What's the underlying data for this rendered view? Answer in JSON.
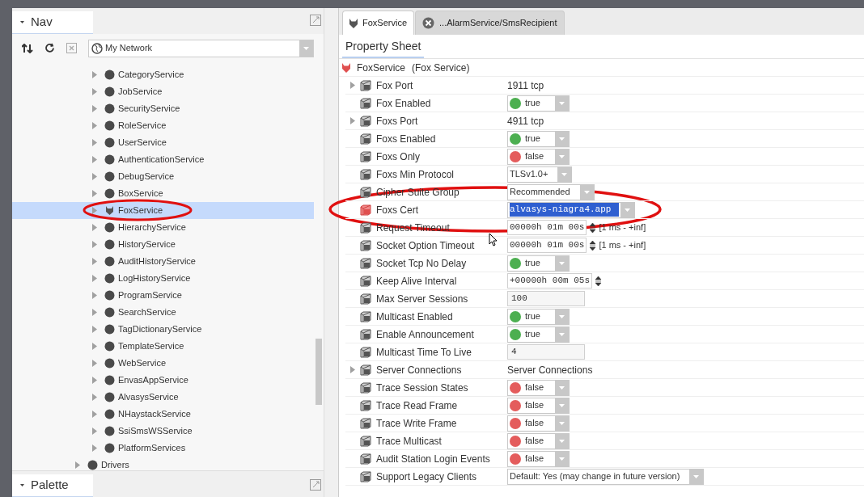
{
  "nav": {
    "title": "Nav",
    "network": "My Network",
    "tree": [
      {
        "children": [
          {
            "label": "CategoryService",
            "expanded": false,
            "selected": false
          },
          {
            "label": "JobService",
            "expanded": false,
            "selected": false
          },
          {
            "label": "SecurityService",
            "expanded": false,
            "selected": false
          },
          {
            "label": "RoleService",
            "expanded": false,
            "selected": false
          },
          {
            "label": "UserService",
            "expanded": false,
            "selected": false
          },
          {
            "label": "AuthenticationService",
            "expanded": false,
            "selected": false
          },
          {
            "label": "DebugService",
            "expanded": false,
            "selected": false
          },
          {
            "label": "BoxService",
            "expanded": false,
            "selected": false
          },
          {
            "label": "FoxService",
            "expanded": false,
            "selected": true
          },
          {
            "label": "HierarchyService",
            "expanded": false,
            "selected": false
          },
          {
            "label": "HistoryService",
            "expanded": false,
            "selected": false
          },
          {
            "label": "AuditHistoryService",
            "expanded": false,
            "selected": false
          },
          {
            "label": "LogHistoryService",
            "expanded": false,
            "selected": false
          },
          {
            "label": "ProgramService",
            "expanded": false,
            "selected": false
          },
          {
            "label": "SearchService",
            "expanded": false,
            "selected": false
          },
          {
            "label": "TagDictionaryService",
            "expanded": false,
            "selected": false
          },
          {
            "label": "TemplateService",
            "expanded": false,
            "selected": false
          },
          {
            "label": "WebService",
            "expanded": false,
            "selected": false
          },
          {
            "label": "EnvasAppService",
            "expanded": false,
            "selected": false
          },
          {
            "label": "AlvasysService",
            "expanded": false,
            "selected": false
          },
          {
            "label": "NHaystackService",
            "expanded": false,
            "selected": false
          },
          {
            "label": "SsiSmsWSService",
            "expanded": false,
            "selected": false
          },
          {
            "label": "PlatformServices",
            "expanded": false,
            "selected": false
          }
        ]
      },
      {
        "label": "Drivers",
        "expanded": false,
        "selected": false
      }
    ]
  },
  "palette": {
    "title": "Palette"
  },
  "tabs": [
    {
      "label": "FoxService",
      "selected": true
    },
    {
      "label": "...AlarmService/SmsRecipient",
      "selected": false
    }
  ],
  "view": {
    "title": "Property Sheet"
  },
  "component": {
    "name": "FoxService",
    "type": "(Fox Service)"
  },
  "properties": [
    {
      "label": "Fox Port",
      "kind": "text",
      "value": "1911 tcp",
      "expanded": false
    },
    {
      "label": "Fox Enabled",
      "kind": "bool",
      "value": "true",
      "on": true
    },
    {
      "label": "Foxs Port",
      "kind": "text",
      "value": "4911 tcp",
      "expanded": false
    },
    {
      "label": "Foxs Enabled",
      "kind": "bool",
      "value": "true",
      "on": true
    },
    {
      "label": "Foxs Only",
      "kind": "bool",
      "value": "false",
      "on": false
    },
    {
      "label": "Foxs Min Protocol",
      "kind": "select",
      "value": "TLSv1.0+"
    },
    {
      "label": "Cipher Suite Group",
      "kind": "select",
      "value": "Recommended"
    },
    {
      "label": "Foxs Cert",
      "kind": "select",
      "value": "alvasys-niagra4.app",
      "text_selected": true
    },
    {
      "label": "Request Timeout",
      "kind": "duration",
      "value": "00000h 01m 00s",
      "range": "[1 ms - +inf]"
    },
    {
      "label": "Socket Option Timeout",
      "kind": "duration",
      "value": "00000h 01m 00s",
      "range": "[1 ms - +inf]"
    },
    {
      "label": "Socket Tcp No Delay",
      "kind": "bool",
      "value": "true",
      "on": true
    },
    {
      "label": "Keep Alive Interval",
      "kind": "duration",
      "value": "+00000h 00m 05s"
    },
    {
      "label": "Max Server Sessions",
      "kind": "field",
      "value": "100"
    },
    {
      "label": "Multicast Enabled",
      "kind": "bool",
      "value": "true",
      "on": true
    },
    {
      "label": "Enable Announcement",
      "kind": "bool",
      "value": "true",
      "on": true
    },
    {
      "label": "Multicast Time To Live",
      "kind": "field",
      "value": "4"
    },
    {
      "label": "Server Connections",
      "kind": "text",
      "value": "Server Connections",
      "expanded": false
    },
    {
      "label": "Trace Session States",
      "kind": "bool",
      "value": "false",
      "on": false
    },
    {
      "label": "Trace Read Frame",
      "kind": "bool",
      "value": "false",
      "on": false
    },
    {
      "label": "Trace Write Frame",
      "kind": "bool",
      "value": "false",
      "on": false
    },
    {
      "label": "Trace Multicast",
      "kind": "bool",
      "value": "false",
      "on": false
    },
    {
      "label": "Audit Station Login Events",
      "kind": "bool",
      "value": "false",
      "on": false
    },
    {
      "label": "Support Legacy Clients",
      "kind": "select",
      "value": "Default: Yes (may change in future version)"
    }
  ]
}
